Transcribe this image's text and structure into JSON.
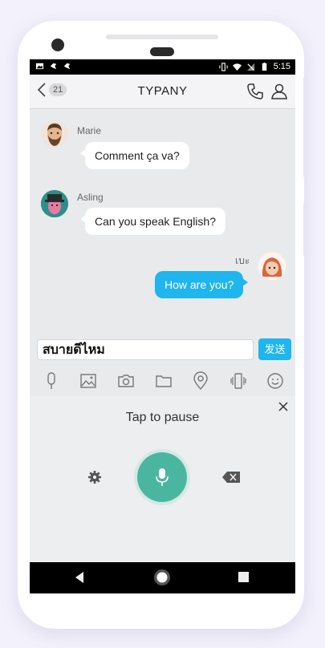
{
  "status_bar": {
    "time": "5:15"
  },
  "header": {
    "back_count": "21",
    "title": "TYPANY"
  },
  "messages": [
    {
      "sender": "Marie",
      "text": "Comment ça va?"
    },
    {
      "sender": "Asling",
      "text": "Can you speak English?"
    },
    {
      "sender": "เบะ",
      "text": "How are you?"
    }
  ],
  "composer": {
    "input_value": "สบายดีไหม",
    "send_label": "发送"
  },
  "voice_panel": {
    "status_label": "Tap to pause"
  },
  "icons": {
    "toolbar": [
      "microphone-icon",
      "image-icon",
      "camera-icon",
      "folder-icon",
      "location-icon",
      "vibrate-icon",
      "emoji-icon"
    ]
  },
  "colors": {
    "accent": "#1fb5ee",
    "mic_button": "#4bb6a0",
    "bubble_out": "#1fb5ee",
    "bubble_in": "#ffffff"
  }
}
